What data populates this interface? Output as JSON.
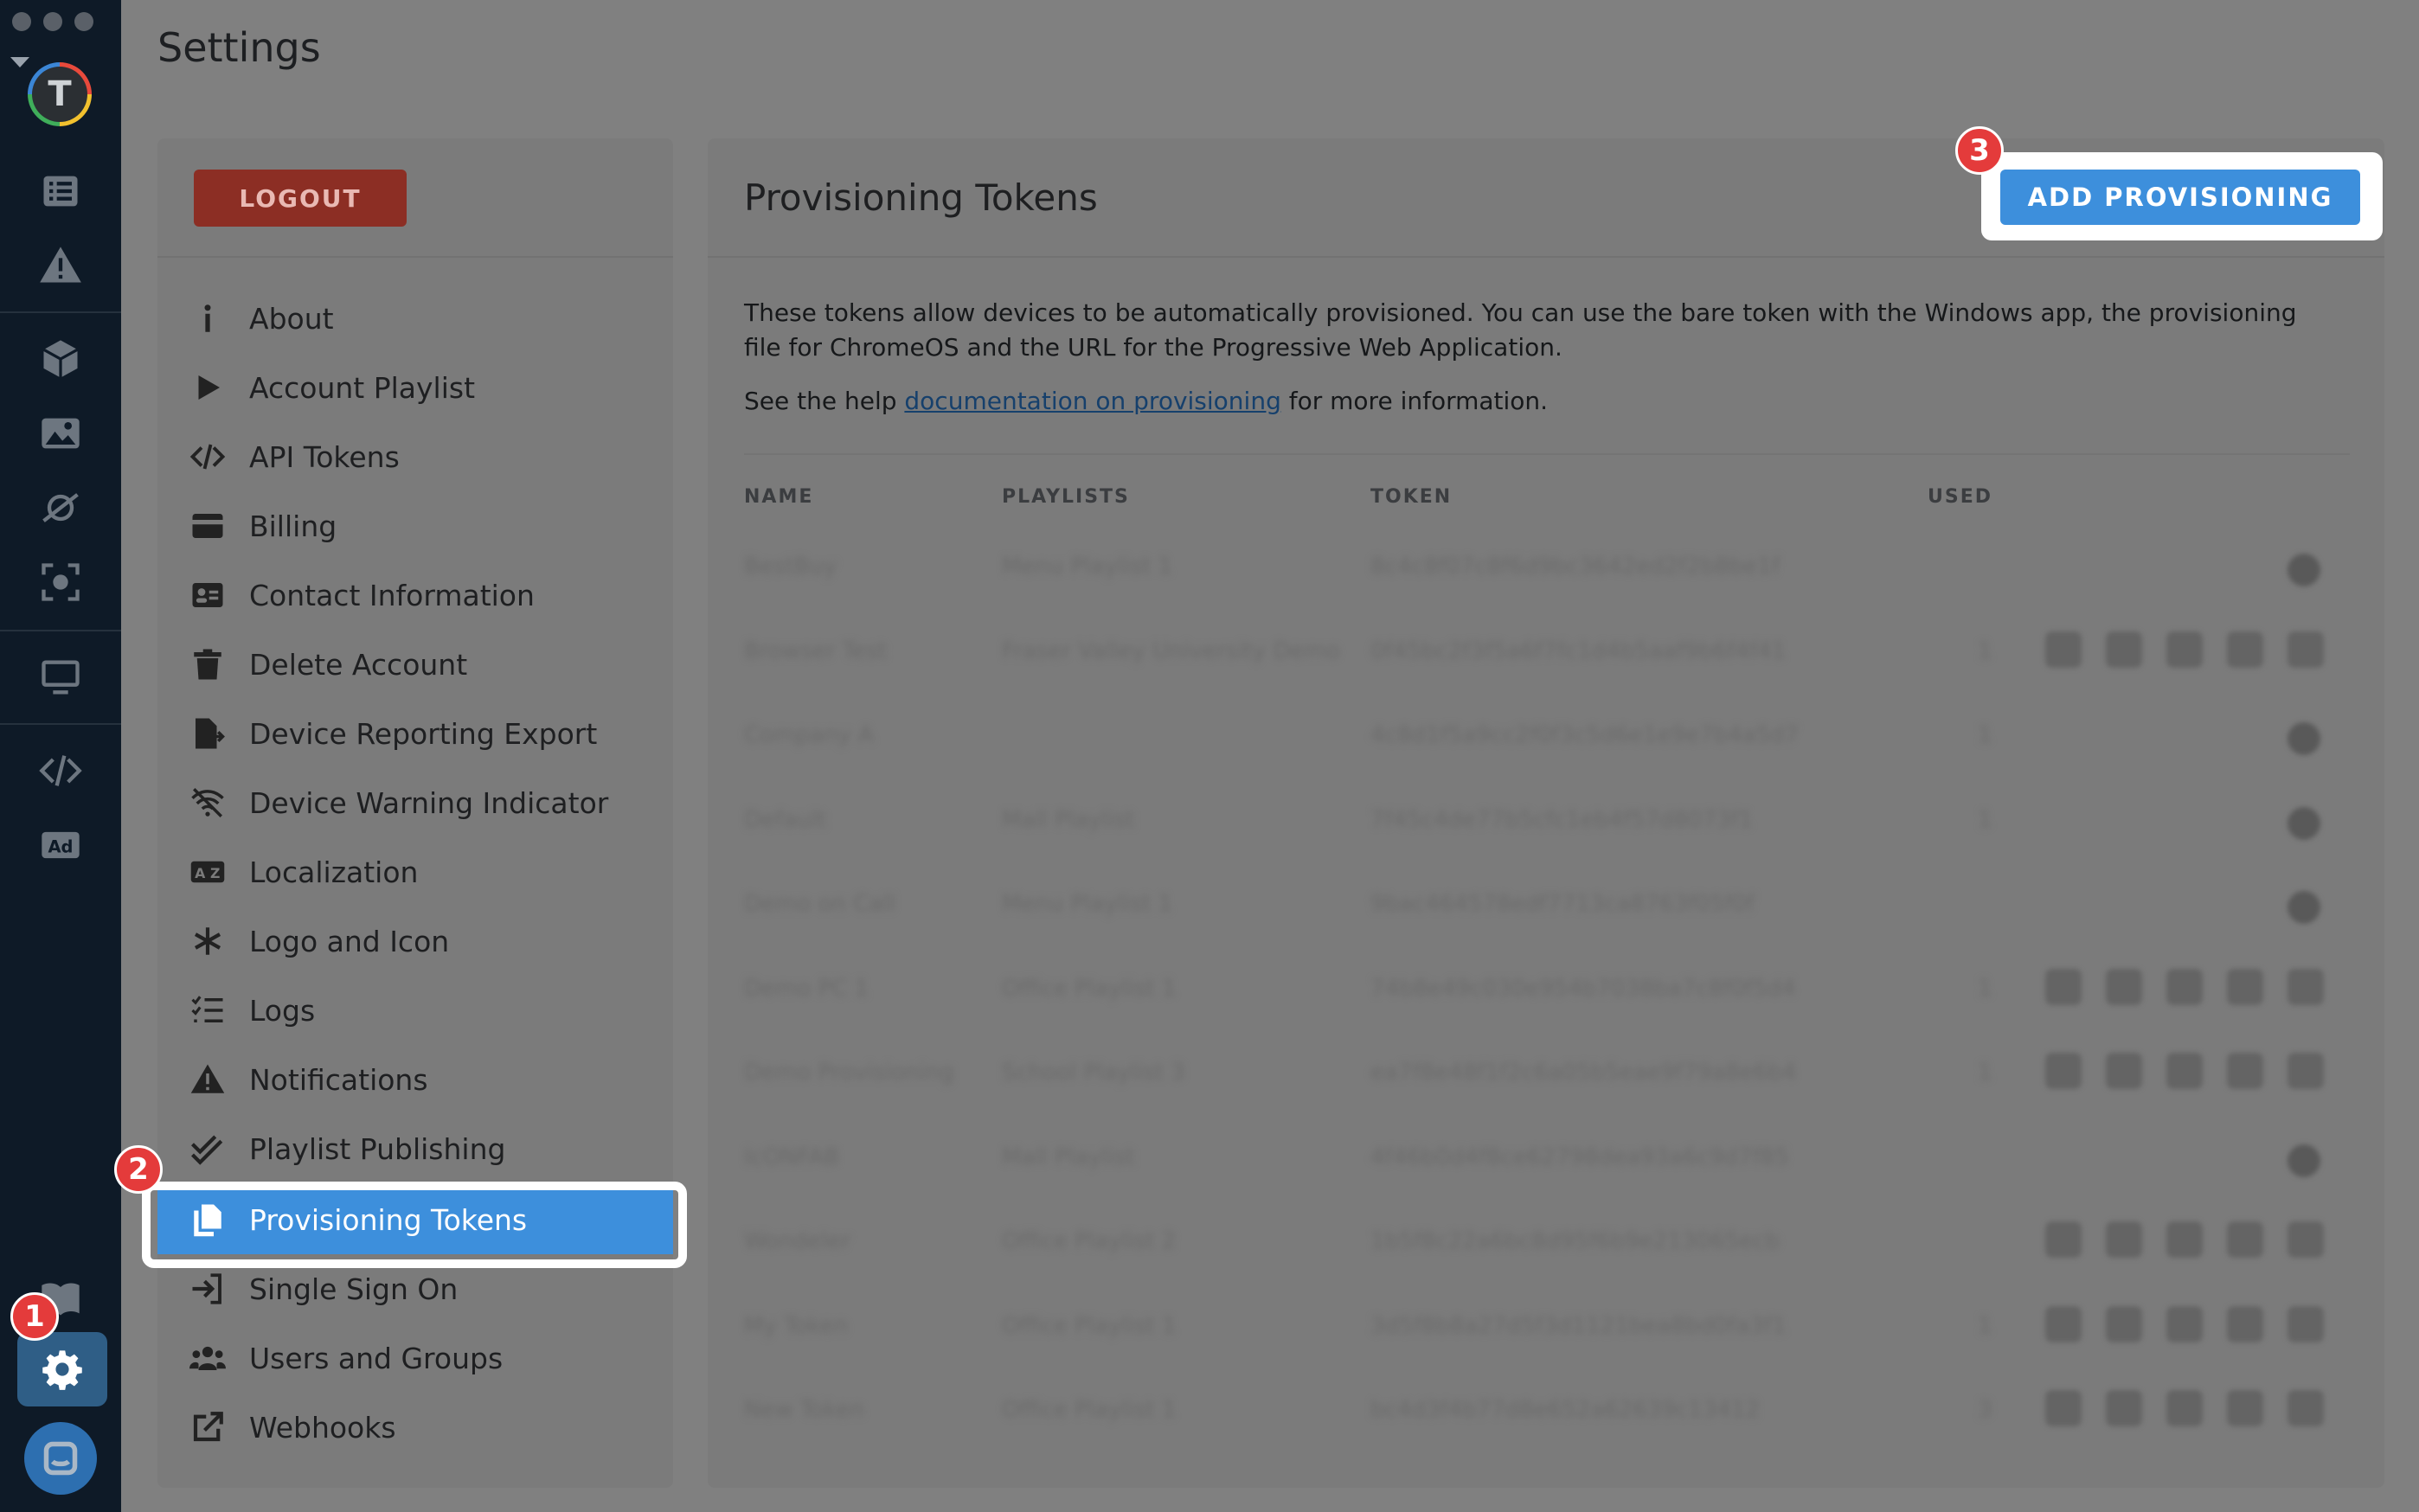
{
  "page": {
    "title": "Settings"
  },
  "rail": {
    "logo_letter": "T",
    "icons": [
      "list-icon",
      "warning-icon",
      "cube-icon",
      "image-icon",
      "satellite-icon",
      "screenshot-icon",
      "monitor-icon",
      "code-icon",
      "ad-icon",
      "book-icon",
      "gear-icon",
      "chat-icon"
    ]
  },
  "steps": {
    "one": "1",
    "two": "2",
    "three": "3"
  },
  "nav": {
    "logout_label": "LOGOUT",
    "items": [
      {
        "label": "About",
        "icon": "info-icon"
      },
      {
        "label": "Account Playlist",
        "icon": "play-icon"
      },
      {
        "label": "API Tokens",
        "icon": "code-icon"
      },
      {
        "label": "Billing",
        "icon": "credit-card-icon"
      },
      {
        "label": "Contact Information",
        "icon": "contact-card-icon"
      },
      {
        "label": "Delete Account",
        "icon": "trash-icon"
      },
      {
        "label": "Device Reporting Export",
        "icon": "file-export-icon"
      },
      {
        "label": "Device Warning Indicator",
        "icon": "wifi-off-icon"
      },
      {
        "label": "Localization",
        "icon": "language-icon"
      },
      {
        "label": "Logo and Icon",
        "icon": "asterisk-icon"
      },
      {
        "label": "Logs",
        "icon": "list-check-icon"
      },
      {
        "label": "Notifications",
        "icon": "warning-icon"
      },
      {
        "label": "Playlist Publishing",
        "icon": "double-check-icon"
      },
      {
        "label": "Provisioning Tokens",
        "icon": "copy-icon"
      },
      {
        "label": "Single Sign On",
        "icon": "sign-in-icon"
      },
      {
        "label": "Users and Groups",
        "icon": "users-icon"
      },
      {
        "label": "Webhooks",
        "icon": "external-link-icon"
      }
    ]
  },
  "main": {
    "title": "Provisioning Tokens",
    "add_button": "ADD PROVISIONING",
    "description": "These tokens allow devices to be automatically provisioned. You can use the bare token with the Windows app, the provisioning file for ChromeOS and the URL for the Progressive Web Application.",
    "help_prefix": "See the help ",
    "help_link": "documentation on provisioning",
    "help_suffix": " for more information.",
    "columns": [
      "NAME",
      "PLAYLISTS",
      "TOKEN",
      "USED"
    ],
    "rows": [
      {
        "name": "BestBuy",
        "playlist": "Menu Playlist 1",
        "token": "8c4c8f07c8f6d9bc3642ed2f2b8be1f",
        "used": "",
        "actions": false
      },
      {
        "name": "Browser Test",
        "playlist": "Fraser Valley University Demo",
        "token": "0f45bc2f3f5a6f7fc1d4b5aaf9b6f4f41",
        "used": "1",
        "actions": true
      },
      {
        "name": "Company A",
        "playlist": "",
        "token": "4c8d1f5a9cc2f0f3c5d6e1e9e7b4a5d7",
        "used": "1",
        "actions": false
      },
      {
        "name": "Default",
        "playlist": "Mall Playlist",
        "token": "7f45c4de77b5cfc1eb4f57d8073f1",
        "used": "1",
        "actions": false
      },
      {
        "name": "Demo on Call",
        "playlist": "Menu Playlist 1",
        "token": "9bac464578edf7713ca8763f05f0f",
        "used": "",
        "actions": false
      },
      {
        "name": "Demo PC 1",
        "playlist": "Office Playlist 1",
        "token": "74b8e49c030e954b7038ba7c8f0f5d4",
        "used": "1",
        "actions": true
      },
      {
        "name": "Demo Provisioning",
        "playlist": "School Playlist 3",
        "token": "ea7f8e48f1f2c6a05b5eae9f79a8e6b4",
        "used": "1",
        "actions": true
      },
      {
        "name": "IcONFAB",
        "playlist": "Mall Playlist",
        "token": "4f46b0d4f8ce62798dea93a6c9d7f85",
        "used": "",
        "actions": false
      },
      {
        "name": "Wondeler",
        "playlist": "Office Playlist 2",
        "token": "1b5f8c22a6bc8d95f6b9e213065ecb",
        "used": "",
        "actions": true
      },
      {
        "name": "My Token",
        "playlist": "Office Playlist 1",
        "token": "3d5f8b8a27d5f3d1121bea8bd0fa3f1",
        "used": "1",
        "actions": true
      },
      {
        "name": "New Token",
        "playlist": "Office Playlist 1",
        "token": "bc4d3f4b77d8e652a62639c13412",
        "used": "3",
        "actions": true
      }
    ]
  },
  "colors": {
    "rail_bg": "#0e1a27",
    "accent": "#3d8fdc",
    "logout": "#8c2e24",
    "badge": "#e43b3b",
    "overlay": "#808080"
  }
}
